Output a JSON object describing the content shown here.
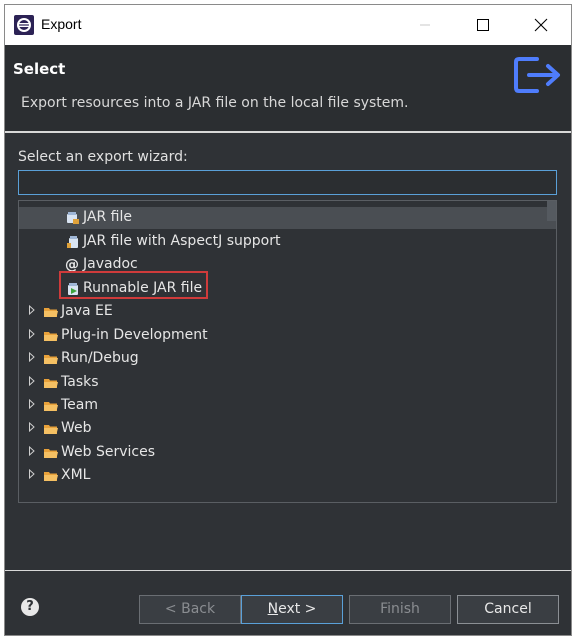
{
  "window": {
    "title": "Export"
  },
  "header": {
    "title": "Select",
    "description": "Export resources into a JAR file on the local file system."
  },
  "filter": {
    "label": "Select an export wizard:",
    "value": "",
    "placeholder": ""
  },
  "tree": {
    "items": [
      {
        "label": "JAR file",
        "icon": "jar-icon",
        "selected": true
      },
      {
        "label": "JAR file with AspectJ support",
        "icon": "aspectj-jar-icon"
      },
      {
        "label": "Javadoc",
        "icon": "javadoc-icon"
      },
      {
        "label": "Runnable JAR file",
        "icon": "runnable-jar-icon",
        "highlighted": true
      },
      {
        "label": "Java EE",
        "icon": "folder-icon"
      },
      {
        "label": "Plug-in Development",
        "icon": "folder-icon"
      },
      {
        "label": "Run/Debug",
        "icon": "folder-icon"
      },
      {
        "label": "Tasks",
        "icon": "folder-icon"
      },
      {
        "label": "Team",
        "icon": "folder-icon"
      },
      {
        "label": "Web",
        "icon": "folder-icon"
      },
      {
        "label": "Web Services",
        "icon": "folder-icon"
      },
      {
        "label": "XML",
        "icon": "folder-icon"
      }
    ]
  },
  "buttons": {
    "back": "< Back",
    "next_mnemonic": "N",
    "next_rest": "ext >",
    "finish": "Finish",
    "cancel": "Cancel"
  },
  "help": {
    "glyph": "?"
  },
  "colors": {
    "accent": "#5aa0d8",
    "export_icon": "#4f7dfc",
    "highlight": "#cf3b3b",
    "folder": "#e8a13a"
  }
}
